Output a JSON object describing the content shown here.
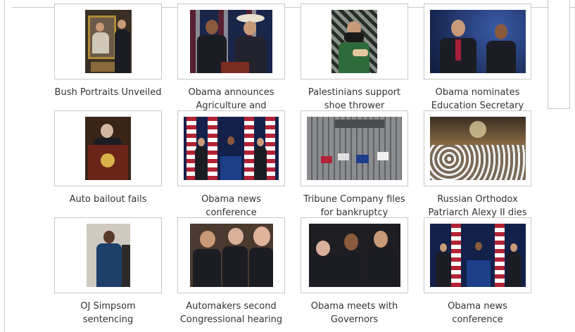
{
  "gallery": {
    "items": [
      {
        "caption": "Bush Portraits Unveiled",
        "thumb_icon": "portrait-photo"
      },
      {
        "caption": "Obama announces Agriculture and",
        "thumb_icon": "press-photo"
      },
      {
        "caption": "Palestinians support shoe thrower",
        "thumb_icon": "protest-photo"
      },
      {
        "caption": "Obama nominates Education Secretary",
        "thumb_icon": "press-photo"
      },
      {
        "caption": "Auto bailout fails",
        "thumb_icon": "podium-photo"
      },
      {
        "caption": "Obama news conference",
        "thumb_icon": "flags-photo"
      },
      {
        "caption": "Tribune Company files for bankruptcy",
        "thumb_icon": "building-photo"
      },
      {
        "caption": "Russian Orthodox Patriarch Alexy II dies",
        "thumb_icon": "church-photo"
      },
      {
        "caption": "OJ Simpsom sentencing",
        "thumb_icon": "courtroom-photo"
      },
      {
        "caption": "Automakers second Congressional hearing",
        "thumb_icon": "hearing-photo"
      },
      {
        "caption": "Obama meets with Governors",
        "thumb_icon": "meeting-photo"
      },
      {
        "caption": "Obama news conference",
        "thumb_icon": "flags-photo"
      }
    ]
  },
  "colors": {
    "border": "#c8c8c8",
    "caption_text": "#333333",
    "background": "#ffffff"
  }
}
